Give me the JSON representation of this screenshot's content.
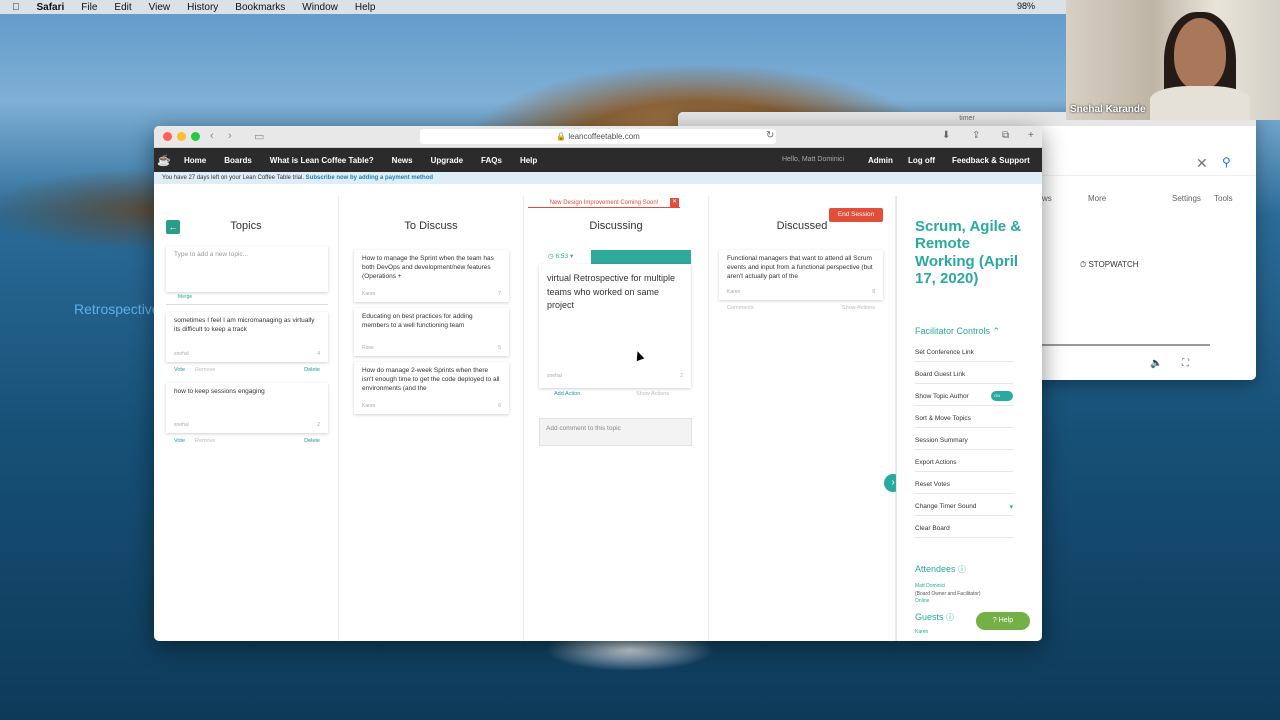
{
  "menubar": {
    "app": "Safari",
    "items": [
      "File",
      "Edit",
      "View",
      "History",
      "Bookmarks",
      "Window",
      "Help"
    ],
    "battery": "98%"
  },
  "background_window": {
    "title": "timer",
    "more": "More",
    "settings": "Settings",
    "tools": "Tools",
    "ws": "ws",
    "stopwatch": "STOPWATCH"
  },
  "webcam": {
    "name": "Snehal Karande"
  },
  "overlay_text": "Retrospective?",
  "browser": {
    "url": "leancoffeetable.com"
  },
  "nav": {
    "home": "Home",
    "boards": "Boards",
    "what": "What is Lean Coffee Table?",
    "news": "News",
    "upgrade": "Upgrade",
    "faqs": "FAQs",
    "help": "Help",
    "hello": "Hello, Matt Dominici",
    "admin": "Admin",
    "logoff": "Log off",
    "feedback": "Feedback & Support"
  },
  "trial": {
    "text": "You have 27 days left on your Lean Coffee Table trial.",
    "link": "Subscribe now by adding a payment method"
  },
  "banner": "New Design Improvement Coming Soon!",
  "end_session": "End Session",
  "columns": {
    "topics": {
      "header": "Topics",
      "input_placeholder": "Type to add a new topic...",
      "merge": "Merge",
      "cards": [
        {
          "text": "sometimes I feel I am micromanaging as virtually its difficult to  keep a track",
          "author": "snehal",
          "votes": "4",
          "vote": "Vote",
          "remove": "Remove",
          "delete": "Delete"
        },
        {
          "text": "how to keep sessions engaging",
          "author": "snehal",
          "votes": "2",
          "vote": "Vote",
          "remove": "Remove",
          "delete": "Delete"
        }
      ]
    },
    "to_discuss": {
      "header": "To Discuss",
      "cards": [
        {
          "text": "How to manage the Sprint when the team has both DevOps and development/new features (Operations +",
          "author": "Karen",
          "votes": "7"
        },
        {
          "text": "Educating on best practices for adding members to a well functioning team",
          "author": "Rose",
          "votes": "5"
        },
        {
          "text": "How do manage 2-week Sprints when there isn't enough time to get the code deployed to all environments  (and the",
          "author": "Karen",
          "votes": "6"
        }
      ]
    },
    "discussing": {
      "header": "Discussing",
      "timer": "6:53",
      "text": "virtual Retrospective for multiple teams  who worked on same project",
      "author": "snehal",
      "votes": "2",
      "add_action": "Add Action",
      "show_actions": "Show Actions",
      "comment_placeholder": "Add comment to this topic"
    },
    "discussed": {
      "header": "Discussed",
      "card": {
        "text": "Functional managers that want to attend all Scrum events and input from a functional perspective (but aren't actually part of the",
        "author": "Karen",
        "votes": "8",
        "comments": "Comments",
        "show_actions": "Show Actions"
      }
    }
  },
  "sidebar": {
    "title": "Scrum, Agile & Remote Working (April 17, 2020)",
    "facilitator": "Facilitator Controls",
    "controls": [
      "Set Conference Link",
      "Board Guest Link",
      "Show Topic Author",
      "Sort & Move Topics",
      "Session Summary",
      "Export Actions",
      "Reset Votes",
      "Change Timer Sound",
      "Clear Board"
    ],
    "toggle_label": "ON",
    "attendees": "Attendees",
    "attendee_name": "Matt Dominici",
    "attendee_role": "(Board Owner and Facilitator)",
    "attendee_status": "Online",
    "guests": "Guests",
    "guest_name": "Karen"
  },
  "help_button": "Help",
  "colors": {
    "teal": "#2aa9a0",
    "red": "#e24e3a",
    "green": "#74b045",
    "dark": "#2b2b2b"
  }
}
